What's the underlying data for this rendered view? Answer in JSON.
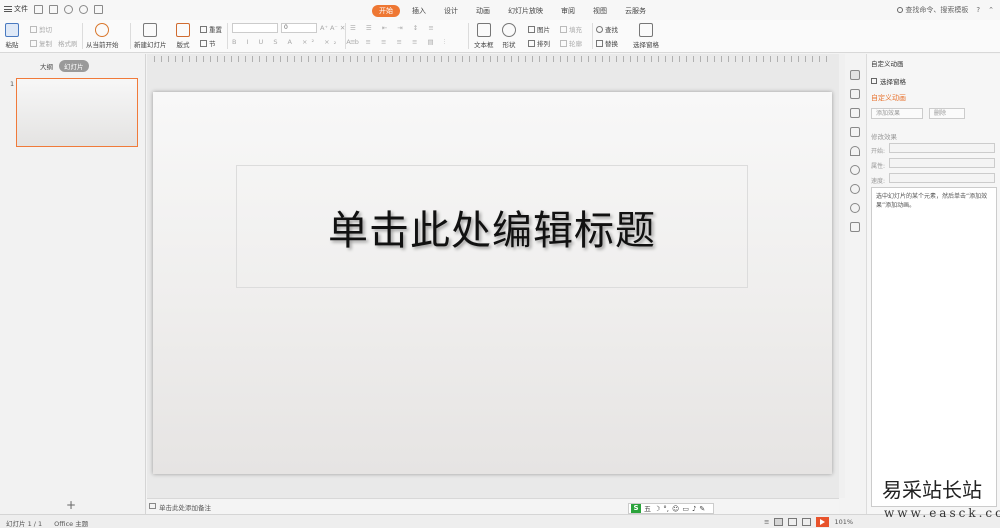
{
  "menu": {
    "file_label": "文件",
    "tabs": [
      "开始",
      "插入",
      "设计",
      "动画",
      "幻灯片放映",
      "审阅",
      "视图",
      "云服务"
    ],
    "active_tab": "开始",
    "search_label": "查找命令、搜索模板",
    "help_label": "?"
  },
  "ribbon": {
    "paste": "粘贴",
    "cut": "剪切",
    "copy": "复制",
    "format_painter": "格式刷",
    "play_from_current": "从当前开始",
    "new_slide": "新建幻灯片",
    "layout": "版式",
    "reset": "重置",
    "section": "节",
    "font_size": "0",
    "textbox": "文本框",
    "shape": "形状",
    "arrange": "排列",
    "picture": "图片",
    "fill": "填充",
    "outline": "轮廓",
    "find": "查找",
    "replace": "替换",
    "select_pane": "选择窗格"
  },
  "left_pane": {
    "tab_outline": "大纲",
    "tab_slides": "幻灯片",
    "slide_number": "1",
    "add_label": "+"
  },
  "slide": {
    "title_placeholder": "单击此处编辑标题"
  },
  "notes": {
    "placeholder": "单击此处添加备注"
  },
  "task_pane": {
    "header": "自定义动画",
    "select_pane": "选择窗格",
    "subheader": "自定义动画",
    "add_effect": "添加效果",
    "delete": "删除",
    "modify_effect": "修改效果",
    "start_label": "开始:",
    "property_label": "属性:",
    "speed_label": "速度:",
    "hint": "选中幻灯片的某个元素，然后单击“添加效果”添加动画。"
  },
  "status": {
    "slide_info": "幻灯片 1 / 1",
    "theme": "Office 主题",
    "zoom": "101%"
  },
  "ime": {
    "label": "五"
  },
  "watermark": {
    "line1": "易采站长站",
    "line2": "www.easck.com"
  }
}
